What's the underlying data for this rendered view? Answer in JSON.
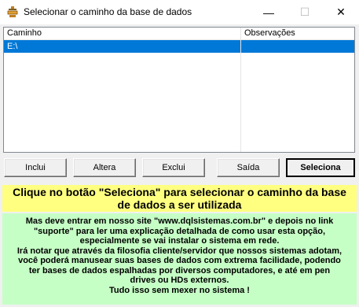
{
  "window": {
    "title": "Selecionar o caminho da base de dados",
    "controls": {
      "minimize": "—",
      "maximize": "☐",
      "close": "✕"
    }
  },
  "list": {
    "columns": [
      "Caminho",
      "Observações"
    ],
    "rows": [
      {
        "caminho": "E:\\",
        "observacoes": "",
        "selected": true
      }
    ]
  },
  "buttons": {
    "inclui": "Inclui",
    "altera": "Altera",
    "exclui": "Exclui",
    "saida": "Saída",
    "seleciona": "Seleciona"
  },
  "instructions": {
    "line1": "Clique no botão \"Seleciona\" para selecionar o caminho da base",
    "line2": "de dados a ser utilizada"
  },
  "info": {
    "lines": [
      "Mas deve entrar em nosso site \"www.dqlsistemas.com.br\" e depois no link",
      "\"suporte\" para ler uma explicação detalhada de como usar esta opção,",
      "especialmente se vai instalar o sistema em rede.",
      "Irá notar que através da filosofia cliente/servidor que nossos sistemas adotam,",
      "você poderá manusear suas bases de dados com extrema facilidade, podendo",
      "ter bases de dados espalhadas por diversos computadores, e até em pen",
      "drives ou HDs externos.",
      "Tudo isso sem mexer no sistema !"
    ]
  },
  "colors": {
    "selection": "#0078d7",
    "instructions_bg": "#ffff80",
    "info_bg": "#c6ffc6"
  },
  "icons": {
    "app": "database-app-icon"
  }
}
